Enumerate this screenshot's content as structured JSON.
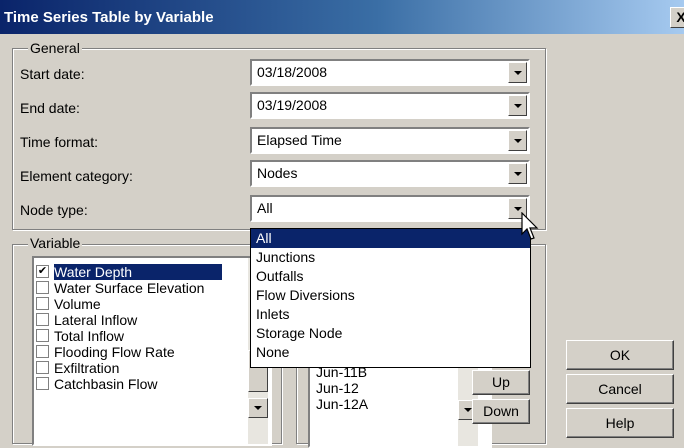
{
  "window": {
    "title": "Time Series Table by Variable",
    "close_label": "X"
  },
  "general": {
    "label": "General",
    "fields": [
      {
        "label": "Start date:",
        "value": "03/18/2008"
      },
      {
        "label": "End date:",
        "value": "03/19/2008"
      },
      {
        "label": "Time format:",
        "value": "Elapsed Time"
      },
      {
        "label": "Element category:",
        "value": "Nodes"
      },
      {
        "label": "Node type:",
        "value": "All"
      }
    ]
  },
  "node_type_dropdown": {
    "options": [
      "All",
      "Junctions",
      "Outfalls",
      "Flow Diversions",
      "Inlets",
      "Storage Node",
      "None"
    ],
    "selected": "All"
  },
  "variable": {
    "label": "Variable",
    "items": [
      {
        "label": "Water Depth",
        "checked": true
      },
      {
        "label": "Water Surface Elevation",
        "checked": false
      },
      {
        "label": "Volume",
        "checked": false
      },
      {
        "label": "Lateral Inflow",
        "checked": false
      },
      {
        "label": "Total Inflow",
        "checked": false
      },
      {
        "label": "Flooding Flow Rate",
        "checked": false
      },
      {
        "label": "Exfiltration",
        "checked": false
      },
      {
        "label": "Catchbasin Flow",
        "checked": false
      }
    ]
  },
  "elements": {
    "items": [
      "Jun-11B",
      "Jun-12",
      "Jun-12A"
    ],
    "up_label": "Up",
    "down_label": "Down"
  },
  "buttons": {
    "ok": "OK",
    "cancel": "Cancel",
    "help": "Help"
  },
  "colors": {
    "title_start": "#0a246a",
    "title_end": "#a6caf0",
    "selection": "#0a246a",
    "face": "#d4d0c8"
  }
}
